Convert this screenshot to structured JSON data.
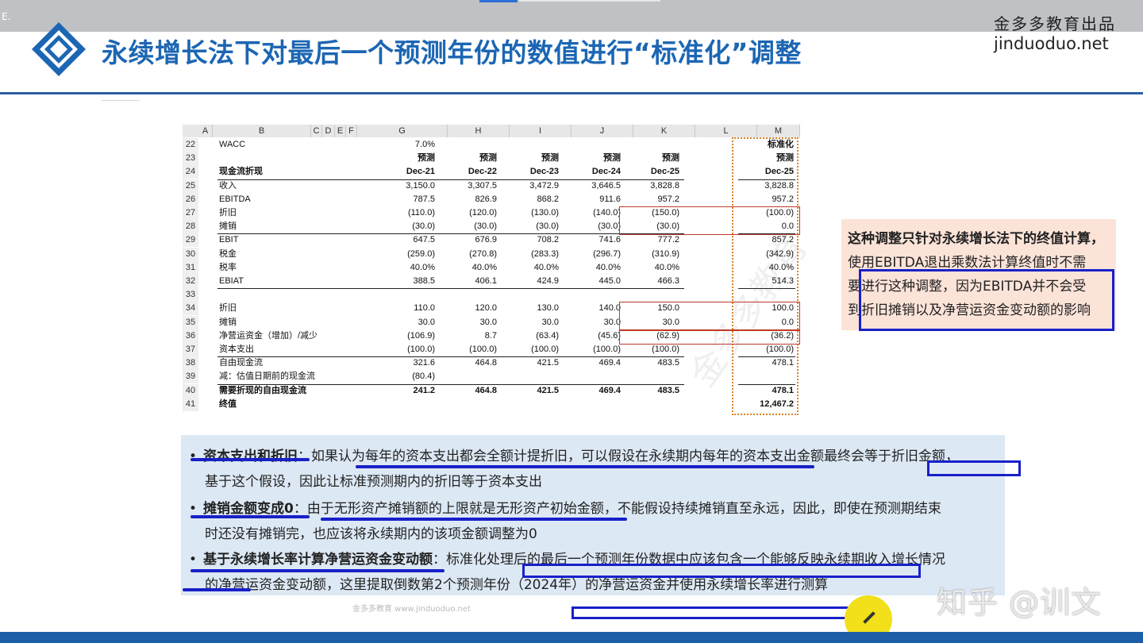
{
  "top_corner_text": "E.",
  "brand": {
    "cn": "金多多教育出品",
    "en": "jinduoduo.net"
  },
  "title": "永续增长法下对最后一个预测年份的数值进行“标准化”调整",
  "sheet": {
    "col_letters": [
      "A",
      "B",
      "C",
      "D",
      "E",
      "F",
      "G",
      "H",
      "I",
      "J",
      "K",
      "L",
      "M"
    ],
    "wacc_label": "WACC",
    "wacc_value": "7.0%",
    "normalized_header": "标准化",
    "forecast_label": "预测",
    "section_label": "现金流折现",
    "periods": [
      "Dec-21",
      "Dec-22",
      "Dec-23",
      "Dec-24",
      "Dec-25",
      "Dec-25"
    ],
    "row_numbers": [
      "22",
      "23",
      "24",
      "25",
      "26",
      "27",
      "28",
      "29",
      "30",
      "31",
      "32",
      "33",
      "34",
      "35",
      "36",
      "37",
      "38",
      "39",
      "40",
      "41"
    ],
    "rows": [
      {
        "label": "收入",
        "values": [
          "3,150.0",
          "3,307.5",
          "3,472.9",
          "3,646.5",
          "3,828.8",
          "3,828.8"
        ]
      },
      {
        "label": "EBITDA",
        "values": [
          "787.5",
          "826.9",
          "868.2",
          "911.6",
          "957.2",
          "957.2"
        ]
      },
      {
        "label": "折旧",
        "values": [
          "(110.0)",
          "(120.0)",
          "(130.0)",
          "(140.0)",
          "(150.0)",
          "(100.0)"
        ]
      },
      {
        "label": "摊销",
        "values": [
          "(30.0)",
          "(30.0)",
          "(30.0)",
          "(30.0)",
          "(30.0)",
          "0.0"
        ]
      },
      {
        "label": "EBIT",
        "values": [
          "647.5",
          "676.9",
          "708.2",
          "741.6",
          "777.2",
          "857.2"
        ]
      },
      {
        "label": "税金",
        "values": [
          "(259.0)",
          "(270.8)",
          "(283.3)",
          "(296.7)",
          "(310.9)",
          "(342.9)"
        ]
      },
      {
        "label": "税率",
        "values": [
          "40.0%",
          "40.0%",
          "40.0%",
          "40.0%",
          "40.0%",
          "40.0%"
        ]
      },
      {
        "label": "EBIAT",
        "values": [
          "388.5",
          "406.1",
          "424.9",
          "445.0",
          "466.3",
          "514.3"
        ]
      },
      {
        "label": "",
        "values": [
          "",
          "",
          "",
          "",
          "",
          ""
        ]
      },
      {
        "label": "折旧",
        "values": [
          "110.0",
          "120.0",
          "130.0",
          "140.0",
          "150.0",
          "100.0"
        ]
      },
      {
        "label": "摊销",
        "values": [
          "30.0",
          "30.0",
          "30.0",
          "30.0",
          "30.0",
          "0.0"
        ]
      },
      {
        "label": "净营运资金（增加）/减少",
        "values": [
          "(106.9)",
          "8.7",
          "(63.4)",
          "(45.6)",
          "(62.9)",
          "(36.2)"
        ]
      },
      {
        "label": "资本支出",
        "values": [
          "(100.0)",
          "(100.0)",
          "(100.0)",
          "(100.0)",
          "(100.0)",
          "(100.0)"
        ]
      },
      {
        "label": "自由现金流",
        "values": [
          "321.6",
          "464.8",
          "421.5",
          "469.4",
          "483.5",
          "478.1"
        ]
      },
      {
        "label": "减：估值日期前的现金流",
        "values": [
          "(80.4)",
          "",
          "",
          "",
          "",
          ""
        ]
      },
      {
        "label": "需要折现的自由现金流",
        "values": [
          "241.2",
          "464.8",
          "421.5",
          "469.4",
          "483.5",
          "478.1"
        ]
      },
      {
        "label": "终值",
        "values": [
          "",
          "",
          "",
          "",
          "",
          "12,467.2"
        ]
      }
    ]
  },
  "note": {
    "line1": "这种调整只针对永续增长法下的终值计算，",
    "line2": "使用EBITDA退出乘数法计算终值时不需",
    "line3": "要进行这种调整，因为EBITDA并不会受",
    "line4": "到折旧摊销以及净营运资金变动额的影响"
  },
  "bullets": [
    {
      "head": "资本支出和折旧",
      "text": "：如果认为每年的资本支出都会全额计提折旧，可以假设在永续期内每年的资本支出金额最终会等于折旧金额，",
      "cont": "基于这个假设，因此让标准预测期内的折旧等于资本支出"
    },
    {
      "head": "摊销金额变成0",
      "text": "：由于无形资产摊销额的上限就是无形资产初始金额，不能假设持续摊销直至永远，因此，即使在预测期结束",
      "cont": "时还没有摊销完，也应该将永续期内的该项金额调整为0"
    },
    {
      "head": "基于永续增长率计算净营运资金变动额",
      "text": "：标准化处理后的最后一个预测年份数据中应该包含一个能够反映永续期收入增长情况",
      "cont": "的净营运资金变动额，这里提取倒数第2个预测年份（2024年）的净营运资金并使用永续增长率进行测算"
    }
  ],
  "footer_faint": "金多多教育 www.jinduoduo.net",
  "zhihu_watermark": "知乎 @训文",
  "colors": {
    "title": "#1c66b3",
    "ink_blue": "#1820c8",
    "note_bg": "#fbe3d8",
    "bullets_bg": "#dce8f4",
    "bottom_bar": "#1d5ea8"
  }
}
